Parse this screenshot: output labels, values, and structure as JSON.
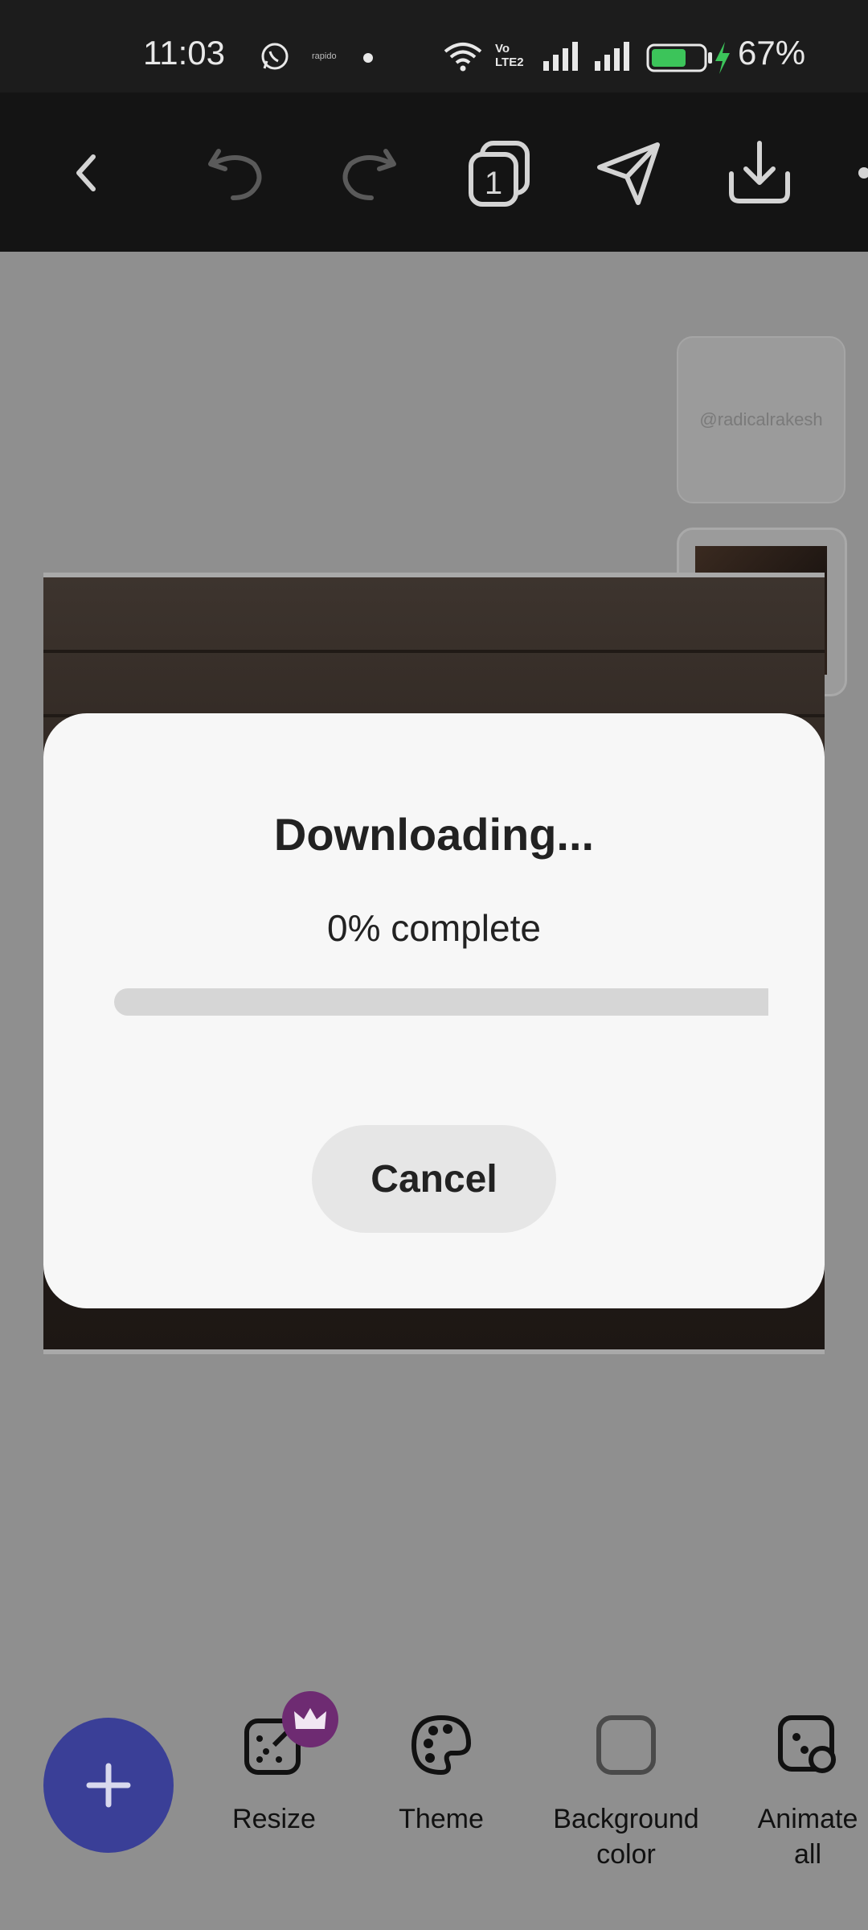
{
  "status_bar": {
    "time": "11:03",
    "notification_label": "rapido",
    "network_type": "Vo LTE2",
    "battery_percent": "67%",
    "battery_level": 0.67,
    "battery_color": "#3cc45a"
  },
  "toolbar": {
    "icons": [
      "back-icon",
      "undo-icon",
      "redo-icon",
      "pages-icon",
      "share-icon",
      "download-icon"
    ],
    "page_count": "1"
  },
  "canvas": {
    "page1_thumbnail_text": "@radicalrakesh"
  },
  "dialog": {
    "title": "Downloading...",
    "status": "0% complete",
    "progress": 0,
    "cancel_label": "Cancel",
    "accent_color": "#3d48c8"
  },
  "bottom_bar": {
    "fab_color": "#3a3f97",
    "tools": [
      {
        "label": "Resize",
        "icon": "resize-icon",
        "premium": true
      },
      {
        "label": "Theme",
        "icon": "palette-icon"
      },
      {
        "label": "Background color",
        "line1": "Background",
        "line2": "color",
        "icon": "color-square-icon"
      },
      {
        "label": "Animate all",
        "line1": "Animate",
        "line2": "all",
        "icon": "animate-icon"
      }
    ]
  }
}
